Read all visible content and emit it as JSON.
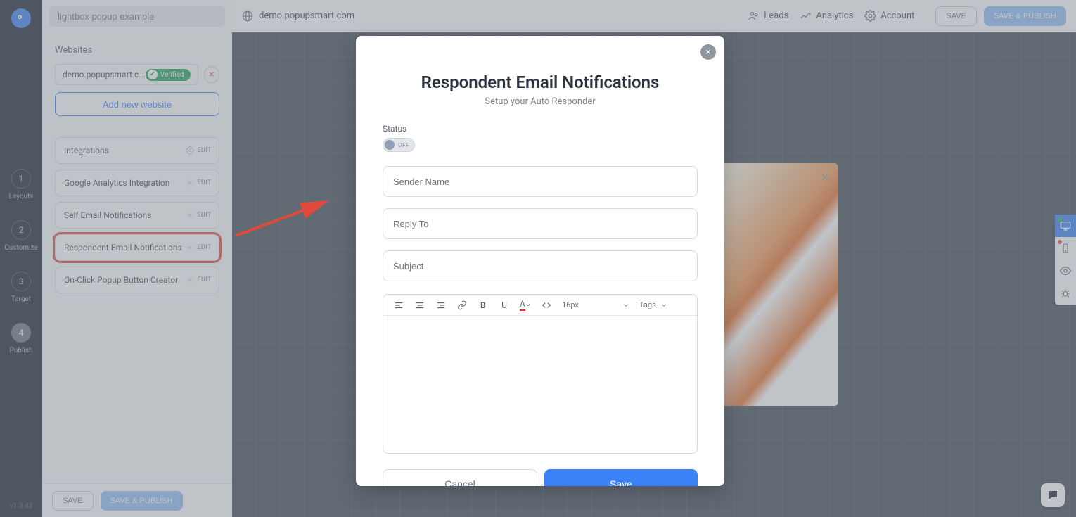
{
  "rail": {
    "steps": [
      {
        "num": "1",
        "label": "Layouts"
      },
      {
        "num": "2",
        "label": "Customize"
      },
      {
        "num": "3",
        "label": "Target"
      },
      {
        "num": "4",
        "label": "Publish"
      }
    ],
    "version": "v1.3.43"
  },
  "header": {
    "campaign_name": "lightbox popup example",
    "domain": "demo.popupsmart.com",
    "links": {
      "leads": "Leads",
      "analytics": "Analytics",
      "account": "Account"
    },
    "save": "SAVE",
    "save_publish": "SAVE & PUBLISH"
  },
  "sidebar": {
    "section_title": "Websites",
    "site": {
      "domain": "demo.popupsmart.c...",
      "verified": "Verified"
    },
    "add_website": "Add new website",
    "options": [
      {
        "label": "Integrations",
        "edit": "EDIT"
      },
      {
        "label": "Google Analytics Integration",
        "edit": "EDIT"
      },
      {
        "label": "Self Email Notifications",
        "edit": "EDIT"
      },
      {
        "label": "Respondent Email Notifications",
        "edit": "EDIT"
      },
      {
        "label": "On-Click Popup Button Creator",
        "edit": "EDIT"
      }
    ],
    "footer": {
      "save": "SAVE",
      "save_publish": "SAVE & PUBLISH"
    }
  },
  "modal": {
    "title": "Respondent Email Notifications",
    "subtitle": "Setup your Auto Responder",
    "status_label": "Status",
    "status_value": "OFF",
    "sender_placeholder": "Sender Name",
    "replyto_placeholder": "Reply To",
    "subject_placeholder": "Subject",
    "font_size": "16px",
    "tags": "Tags",
    "cancel": "Cancel",
    "save": "Save"
  }
}
